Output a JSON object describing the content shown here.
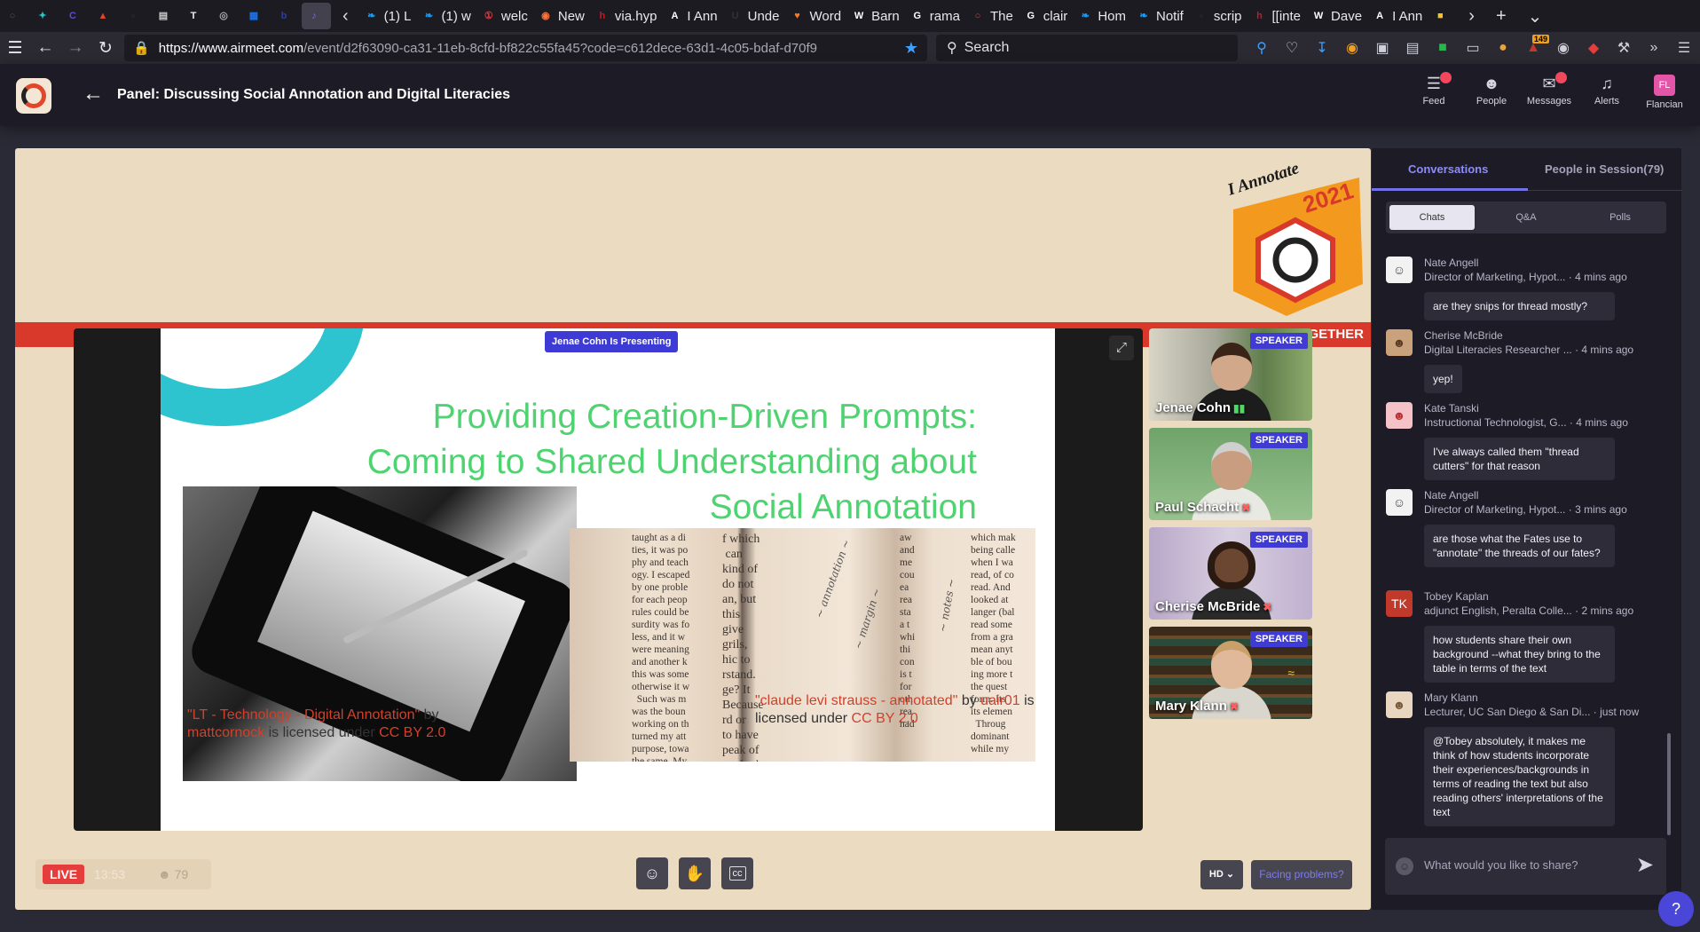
{
  "browser": {
    "tabs": [
      {
        "label": "",
        "icon": "firefox-view-icon",
        "color": "#555"
      },
      {
        "label": "",
        "icon": "puzzle-icon",
        "color": "#1fc8c8"
      },
      {
        "label": "",
        "icon": "c-icon",
        "color": "#5b4bdb"
      },
      {
        "label": "",
        "icon": "gitlab-icon",
        "color": "#e24329"
      },
      {
        "label": "",
        "icon": "medium-icon",
        "color": "#222"
      },
      {
        "label": "",
        "icon": "reader-icon",
        "color": "#ccc"
      },
      {
        "label": "",
        "icon": "t-icon",
        "color": "#eee"
      },
      {
        "label": "",
        "icon": "globe-icon",
        "color": "#aaa"
      },
      {
        "label": "",
        "icon": "calendar-icon",
        "color": "#1a73e8"
      },
      {
        "label": "",
        "icon": "b-icon",
        "color": "#2b3f9f"
      },
      {
        "label": "",
        "icon": "speaker-icon",
        "color": "#7570f0"
      },
      {
        "label": "(1) L",
        "icon": "twitter-icon",
        "color": "#1d9bf0"
      },
      {
        "label": "(1) w",
        "icon": "twitter-icon",
        "color": "#1d9bf0"
      },
      {
        "label": "welc",
        "icon": "badge-icon",
        "color": "#e53c3c"
      },
      {
        "label": "New",
        "icon": "firefox-icon",
        "color": "#ff7139"
      },
      {
        "label": "via.hyp",
        "icon": "hypothesis-icon",
        "color": "#bd1c2b"
      },
      {
        "label": "I Ann",
        "icon": "a-icon",
        "color": "#fff"
      },
      {
        "label": "Unde",
        "icon": "u-icon",
        "color": "#333"
      },
      {
        "label": "Word",
        "icon": "heart-icon",
        "color": "#f57c28"
      },
      {
        "label": "Barn",
        "icon": "wikipedia-icon",
        "color": "#fff"
      },
      {
        "label": "rama",
        "icon": "google-icon",
        "color": "#fff"
      },
      {
        "label": "The",
        "icon": "chat-icon",
        "color": "#e53c3c"
      },
      {
        "label": "clair",
        "icon": "google-icon",
        "color": "#fff"
      },
      {
        "label": "Hom",
        "icon": "twitter-icon",
        "color": "#1d9bf0"
      },
      {
        "label": "Notif",
        "icon": "twitter-icon",
        "color": "#1d9bf0"
      },
      {
        "label": "scrip",
        "icon": "github-icon",
        "color": "#222"
      },
      {
        "label": "[[inte",
        "icon": "h-icon",
        "color": "#bd1c2b"
      },
      {
        "label": "Dave",
        "icon": "wikipedia-icon",
        "color": "#fff"
      },
      {
        "label": "I Ann",
        "icon": "a-icon",
        "color": "#fff"
      },
      {
        "label": "",
        "icon": "note-icon",
        "color": "#f7c31c"
      }
    ],
    "url_host": "https://www.airmeet.com",
    "url_path": "/event/d2f63090-ca31-11eb-8cfd-bf822c55fa45?code=c612dece-63d1-4c05-bdaf-d70f9",
    "search_placeholder": "Search",
    "ext_badge": "149"
  },
  "app": {
    "event_title": "Panel: Discussing Social Annotation and Digital Literacies",
    "nav": [
      {
        "label": "Feed",
        "icon": "feed-icon"
      },
      {
        "label": "People",
        "icon": "people-icon"
      },
      {
        "label": "Messages",
        "icon": "messages-icon"
      },
      {
        "label": "Alerts",
        "icon": "bell-icon"
      },
      {
        "label": "Flancian",
        "icon": "avatar"
      }
    ],
    "avatar_initials": "FL"
  },
  "stage": {
    "badge_brand": "I Annotate",
    "badge_year": "2021",
    "band_text": "GETHER",
    "presenting": "Jenae Cohn Is Presenting",
    "slide": {
      "title_lines": [
        "Providing Creation-Driven Prompts:",
        "Coming to Shared Understanding about",
        "Social Annotation"
      ],
      "credit_left": {
        "q": "\"LT - Technology - Digital Annotation\"",
        "by": " by ",
        "author": "mattcornock",
        "mid": " is licensed under ",
        "license": "CC BY 2.0"
      },
      "credit_right": {
        "q": "\"claude levi strauss - annotated\"",
        "by": " by ",
        "author": "uair01",
        "mid": " is licensed under ",
        "license": "CC BY 2.0"
      }
    },
    "speakers": [
      {
        "name": "Jenae Cohn",
        "tag": "SPEAKER",
        "status": "speaking"
      },
      {
        "name": "Paul Schacht",
        "tag": "SPEAKER",
        "status": "muted"
      },
      {
        "name": "Cherise McBride",
        "tag": "SPEAKER",
        "status": "muted"
      },
      {
        "name": "Mary Klann",
        "tag": "SPEAKER",
        "status": "muted"
      }
    ],
    "live_label": "LIVE",
    "timer": "13:53",
    "viewer_count": "79",
    "hd_label": "HD",
    "facing_problems": "Facing problems?"
  },
  "sidebar": {
    "tab_conversations": "Conversations",
    "tab_people": "People in Session(79)",
    "seg": [
      "Chats",
      "Q&A",
      "Polls"
    ],
    "messages": [
      {
        "name": "Nate Angell",
        "role": "Director of Marketing, Hypot...",
        "time": "4 mins ago",
        "text": "are they snips for thread mostly?"
      },
      {
        "name": "Cherise McBride",
        "role": "Digital Literacies Researcher ...",
        "time": "4 mins ago",
        "text": "yep!"
      },
      {
        "name": "Kate Tanski",
        "role": "Instructional Technologist, G...",
        "time": "4 mins ago",
        "text": "I've always called them \"thread cutters\" for that reason"
      },
      {
        "name": "Nate Angell",
        "role": "Director of Marketing, Hypot...",
        "time": "3 mins ago",
        "text": "are those what the Fates use to \"annotate\" the threads of our fates?"
      },
      {
        "name": "Tobey Kaplan",
        "role": "adjunct English, Peralta Colle...",
        "time": "2 mins ago",
        "text": "how students share their own background --what they bring to the table in terms of the text",
        "initials": "TK"
      },
      {
        "name": "Mary Klann",
        "role": "Lecturer, UC San Diego & San Di...",
        "time": "just now",
        "text": "@Tobey absolutely, it makes me think of how students incorporate their experiences/backgrounds in terms of reading the text but also reading others' interpretations of the text"
      }
    ],
    "input_placeholder": "What would you like to share?"
  }
}
